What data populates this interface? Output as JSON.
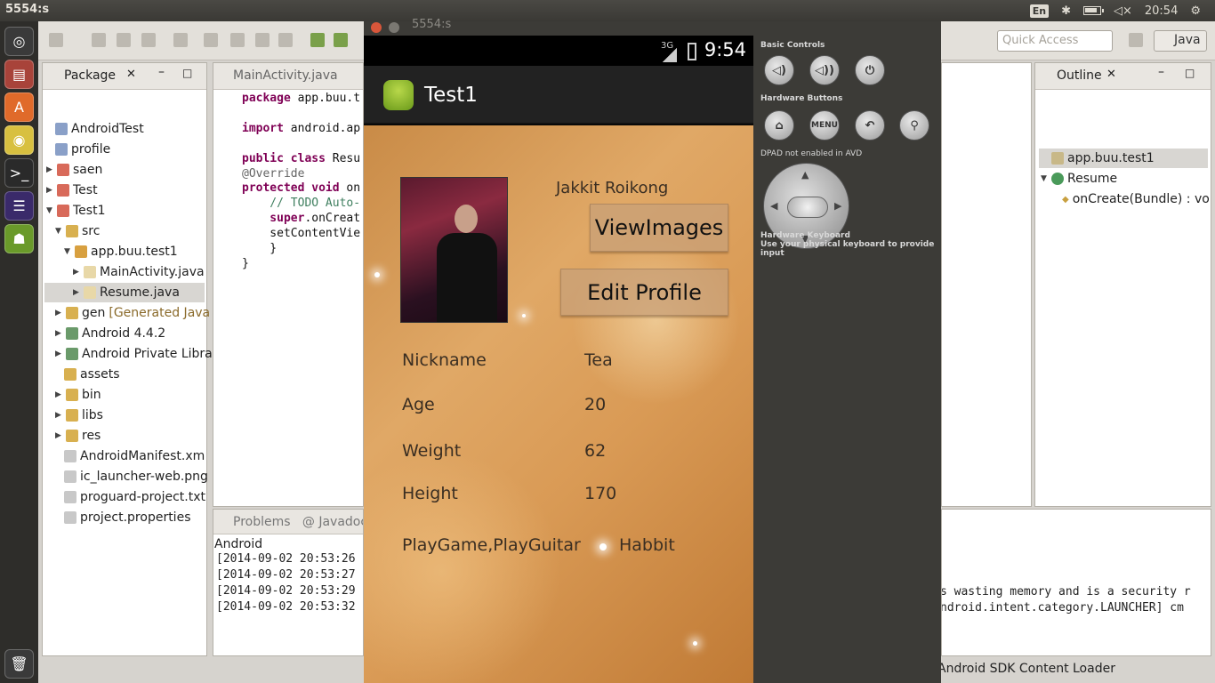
{
  "topbar": {
    "window_title": "5554:s",
    "keyboard_layout": "En",
    "clock": "20:54"
  },
  "toolbar": {
    "quick_access_placeholder": "Quick Access",
    "perspective": "Java"
  },
  "package_explorer": {
    "tab_label": "Package",
    "items": [
      {
        "label": "AndroidTest"
      },
      {
        "label": "profile"
      },
      {
        "label": "saen"
      },
      {
        "label": "Test"
      },
      {
        "label": "Test1"
      },
      {
        "label": "src"
      },
      {
        "label": "app.buu.test1"
      },
      {
        "label": "MainActivity.java"
      },
      {
        "label": "Resume.java"
      },
      {
        "label": "gen",
        "suffix": "[Generated Java"
      },
      {
        "label": "Android 4.4.2"
      },
      {
        "label": "Android Private Libra"
      },
      {
        "label": "assets"
      },
      {
        "label": "bin"
      },
      {
        "label": "libs"
      },
      {
        "label": "res"
      },
      {
        "label": "AndroidManifest.xm"
      },
      {
        "label": "ic_launcher-web.png"
      },
      {
        "label": "proguard-project.txt"
      },
      {
        "label": "project.properties"
      }
    ]
  },
  "editor": {
    "tab_label": "MainActivity.java",
    "line1_kw": "package",
    "line1_rest": " app.buu.t",
    "line2_kw": "import",
    "line2_rest": " android.ap",
    "line3_kw": "public class",
    "line3_rest": " Resu",
    "line4_ann": "@Override",
    "line5_kw": "protected void",
    "line5_rest": " on",
    "line6_cm": "    // TODO Auto-",
    "line7_kw": "    super",
    "line7_rest": ".onCreat",
    "line8": "    setContentVie",
    "line9": "    }",
    "line10": "}"
  },
  "console": {
    "tab_problems": "Problems",
    "tab_javadoc": "Javadoc",
    "label": "Android",
    "lines": [
      "[2014-09-02 20:53:26",
      "[2014-09-02 20:53:27",
      "[2014-09-02 20:53:29",
      "[2014-09-02 20:53:32"
    ],
    "right_lines": [
      "s wasting memory and is a security r",
      "ndroid.intent.category.LAUNCHER] cm"
    ]
  },
  "outline": {
    "tab_label": "Outline",
    "items": [
      {
        "label": "app.buu.test1"
      },
      {
        "label": "Resume"
      },
      {
        "label": "onCreate(Bundle) : vo"
      }
    ]
  },
  "status_line": "Android SDK Content Loader",
  "emulator": {
    "window_title": "5554:s",
    "signal_label": "3G",
    "clock": "9:54",
    "app_title": "Test1",
    "profile": {
      "name": "Jakkit Roikong",
      "view_images_button": "ViewImages",
      "edit_profile_button": "Edit Profile",
      "fields": [
        {
          "label": "Nickname",
          "value": "Tea"
        },
        {
          "label": "Age",
          "value": "20"
        },
        {
          "label": "Weight",
          "value": "62"
        },
        {
          "label": "Height",
          "value": "170"
        }
      ],
      "hobbies_value": "PlayGame,PlayGuitar",
      "hobbies_label": "Habbit"
    },
    "controls": {
      "basic_controls": "Basic Controls",
      "hardware_buttons": "Hardware Buttons",
      "menu_label": "MENU",
      "dpad_label": "DPAD not enabled in AVD",
      "hw_keyboard_title": "Hardware Keyboard",
      "hw_keyboard_desc": "Use your physical keyboard to provide input"
    }
  }
}
